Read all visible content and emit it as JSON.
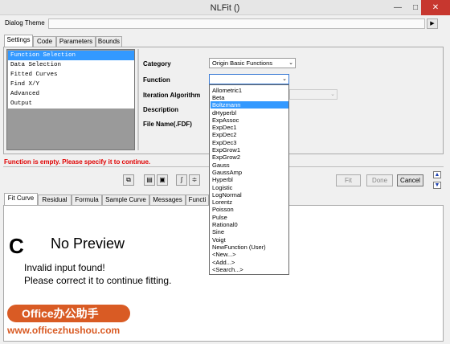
{
  "window": {
    "title": "NLFit ()"
  },
  "dialog_theme": {
    "label": "Dialog Theme"
  },
  "top_tabs": [
    "Settings",
    "Code",
    "Parameters",
    "Bounds"
  ],
  "settings_list": [
    "Function Selection",
    "Data Selection",
    "Fitted Curves",
    "Find X/Y",
    "Advanced",
    "Output"
  ],
  "form": {
    "category_label": "Category",
    "category_value": "Origin Basic Functions",
    "function_label": "Function",
    "function_value": "",
    "iteration_label": "Iteration Algorithm",
    "description_label": "Description",
    "filename_label": "File Name(.FDF)"
  },
  "function_options": [
    "Allometric1",
    "Beta",
    "Boltzmann",
    "dHyperbl",
    "ExpAssoc",
    "ExpDec1",
    "ExpDec2",
    "ExpDec3",
    "ExpGrow1",
    "ExpGrow2",
    "Gauss",
    "GaussAmp",
    "Hyperbl",
    "Logistic",
    "LogNormal",
    "Lorentz",
    "Poisson",
    "Pulse",
    "Rational0",
    "Sine",
    "Voigt",
    "NewFunction (User)",
    "<New...>",
    "<Add...>",
    "<Search...>"
  ],
  "highlighted_option": "Boltzmann",
  "error_message": "Function is empty. Please specify it to continue.",
  "buttons": {
    "fit": "Fit",
    "done": "Done",
    "cancel": "Cancel"
  },
  "bottom_tabs": [
    "Fit Curve",
    "Residual",
    "Formula",
    "Sample Curve",
    "Messages",
    "Functi"
  ],
  "preview": {
    "big_letter": "C",
    "title": "No Preview",
    "line1": "Invalid input found!",
    "line2": "Please correct it to continue fitting."
  },
  "watermark": {
    "brand": "Office办公助手",
    "url": "www.officezhushou.com"
  },
  "colors": {
    "error": "#e00000",
    "selection": "#3399ff",
    "close": "#c7372f",
    "watermark": "#d95b24"
  }
}
